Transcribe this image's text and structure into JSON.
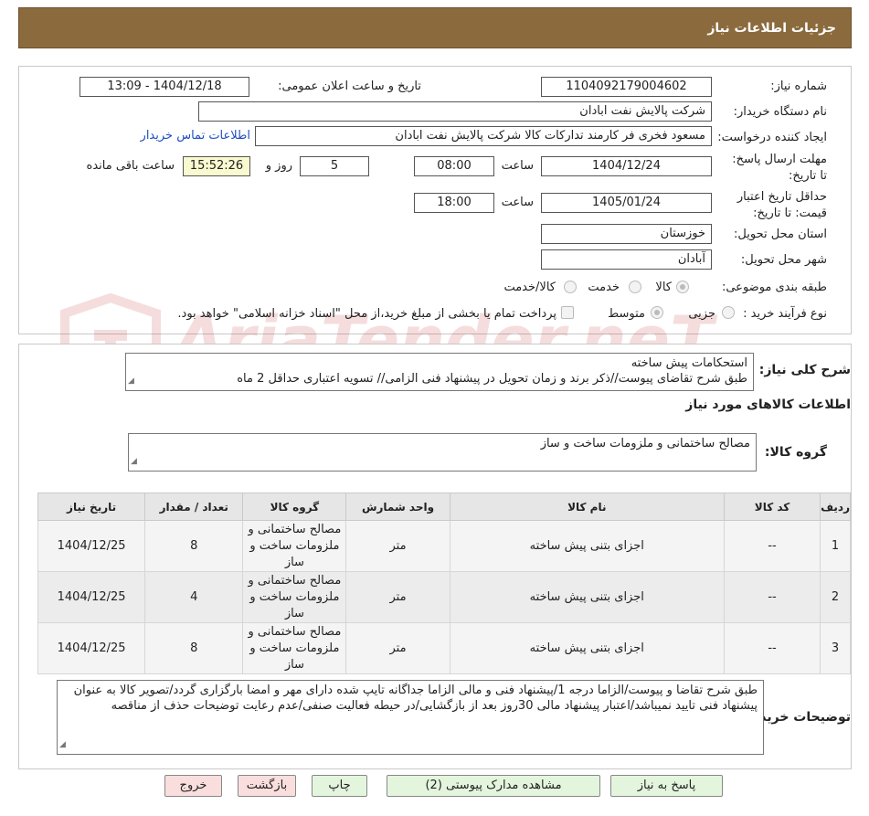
{
  "header": {
    "title": "جزئیات اطلاعات نیاز"
  },
  "watermark": {
    "text": "AriaTender.neT"
  },
  "need_info": {
    "need_number_label": "شماره نیاز:",
    "need_number": "1104092179004602",
    "announce_label": "تاریخ و ساعت اعلان عمومی:",
    "announce_value": "1404/12/18 - 13:09",
    "buyer_org_label": "نام دستگاه خریدار:",
    "buyer_org": "شرکت پالایش نفت ابادان",
    "creator_label": "ایجاد کننده درخواست:",
    "creator": "مسعود فخری فر کارمند تداركات كالا شركت پالایش نفت ابادان",
    "contact_link": "اطلاعات تماس خریدار",
    "deadline_label": "مهلت ارسال پاسخ: تا تاریخ:",
    "deadline_date": "1404/12/24",
    "time_label": "ساعت",
    "deadline_time": "08:00",
    "days_value": "5",
    "days_label": "روز و",
    "remaining_time": "15:52:26",
    "remaining_label": "ساعت باقی مانده",
    "validity_label": "حداقل تاریخ اعتبار قیمت: تا تاریخ:",
    "validity_date": "1405/01/24",
    "validity_time": "18:00",
    "province_label": "استان محل تحویل:",
    "province": "خوزستان",
    "city_label": "شهر محل تحویل:",
    "city": "آبادان",
    "category_label": "طبقه بندی موضوعی:",
    "category_options": [
      "کالا",
      "خدمت",
      "کالا/خدمت"
    ],
    "process_label": "نوع فرآیند خرید :",
    "process_options": [
      "جزیی",
      "متوسط"
    ],
    "payment_note": "پرداخت تمام یا بخشی از مبلغ خرید،از محل \"اسناد خزانه اسلامی\" خواهد بود."
  },
  "summary": {
    "label": "شرح کلی نیاز:",
    "line1": "استحکامات پیش ساخته",
    "line2": "طبق شرح تقاضای پیوست//ذکر برند و زمان تحویل در پیشنهاد فنی الزامی// تسویه اعتباری حداقل 2 ماه"
  },
  "goods": {
    "section_title": "اطلاعات کالاهای مورد نیاز",
    "group_label": "گروه کالا:",
    "group_value": "مصالح ساختمانی و ملزومات ساخت و ساز",
    "columns": [
      "ردیف",
      "کد کالا",
      "نام کالا",
      "واحد شمارش",
      "گروه کالا",
      "تعداد / مقدار",
      "تاریخ نیاز"
    ],
    "rows": [
      {
        "row": "1",
        "code": "--",
        "name": "اجزای بتنی پیش ساخته",
        "unit": "متر",
        "group": "مصالح ساختمانی و ملزومات ساخت و ساز",
        "qty": "8",
        "date": "1404/12/25"
      },
      {
        "row": "2",
        "code": "--",
        "name": "اجزای بتنی پیش ساخته",
        "unit": "متر",
        "group": "مصالح ساختمانی و ملزومات ساخت و ساز",
        "qty": "4",
        "date": "1404/12/25"
      },
      {
        "row": "3",
        "code": "--",
        "name": "اجزای بتنی پیش ساخته",
        "unit": "متر",
        "group": "مصالح ساختمانی و ملزومات ساخت و ساز",
        "qty": "8",
        "date": "1404/12/25"
      }
    ]
  },
  "buyer_notes": {
    "label": "توضیحات خریدار:",
    "text": "طبق شرح تقاضا و پیوست/الزاما درجه 1/پیشنهاد فنی و مالی الزاما جداگانه تایپ شده دارای مهر و امضا بارگزاری گردد/تصویر کالا به عنوان پیشنهاد فنی تایید نمیباشد/اعتبار پیشنهاد مالی 30روز بعد از بازگشایی/در حیطه فعالیت صنفی/عدم رعایت توضیحات حذف از مناقصه"
  },
  "buttons": {
    "reply": "پاسخ به نیاز",
    "attachments": "مشاهده مدارک پیوستی (2)",
    "print": "چاپ",
    "back": "بازگشت",
    "exit": "خروج"
  }
}
